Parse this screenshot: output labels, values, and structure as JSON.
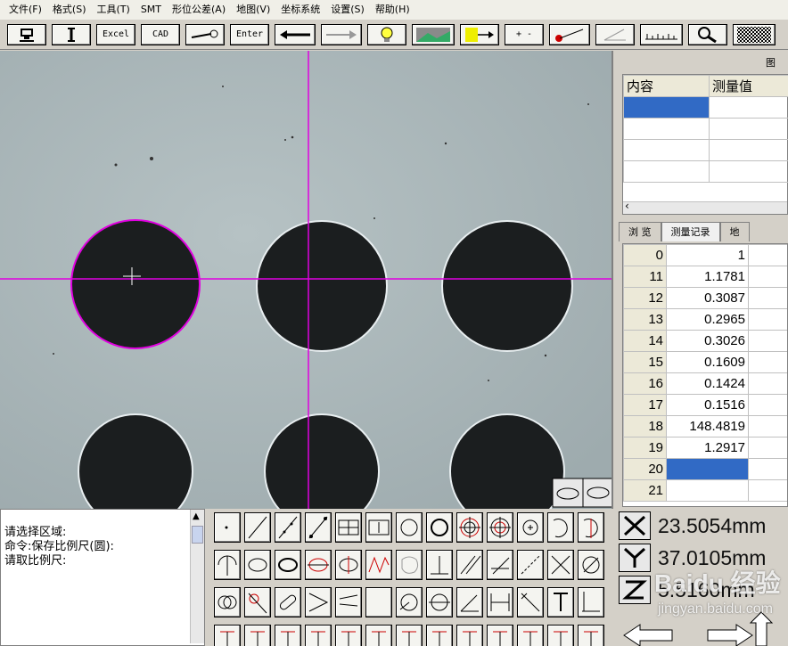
{
  "menu": [
    "文件(F)",
    "格式(S)",
    "工具(T)",
    "SMT",
    "形位公差(A)",
    "地图(V)",
    "坐标系统",
    "设置(S)",
    "帮助(H)"
  ],
  "toolbar": {
    "excel": "Excel",
    "cad": "CAD",
    "enter": "Enter",
    "plusminus": "+ -"
  },
  "right_panel": {
    "panel_title": "图",
    "col_content": "内容",
    "col_measure": "测量值",
    "tabs": [
      "浏 览",
      "测量记录",
      "地"
    ],
    "records": [
      {
        "id": "0",
        "value": "1"
      },
      {
        "id": "11",
        "value": "1.1781"
      },
      {
        "id": "12",
        "value": "0.3087"
      },
      {
        "id": "13",
        "value": "0.2965"
      },
      {
        "id": "14",
        "value": "0.3026"
      },
      {
        "id": "15",
        "value": "0.1609"
      },
      {
        "id": "16",
        "value": "0.1424"
      },
      {
        "id": "17",
        "value": "0.1516"
      },
      {
        "id": "18",
        "value": "148.4819"
      },
      {
        "id": "19",
        "value": "1.2917"
      },
      {
        "id": "20",
        "value": ""
      },
      {
        "id": "21",
        "value": ""
      }
    ]
  },
  "console": {
    "line1": "请选择区域:",
    "line2": "命令:保存比例尺(圆):",
    "line3": "请取比例尺:"
  },
  "coords": {
    "x_label": "X",
    "x_value": "23.5054mm",
    "y_label": "Y",
    "y_value": "37.0105mm",
    "z_label": "Z",
    "z_value": "5.5160mm"
  },
  "watermark": {
    "brand": "Baidu 经验",
    "url": "jingyan.baidu.com"
  },
  "colors": {
    "crosshair": "#e000e0",
    "selection": "#316ac5",
    "circle_fill": "#1b1e1f"
  }
}
